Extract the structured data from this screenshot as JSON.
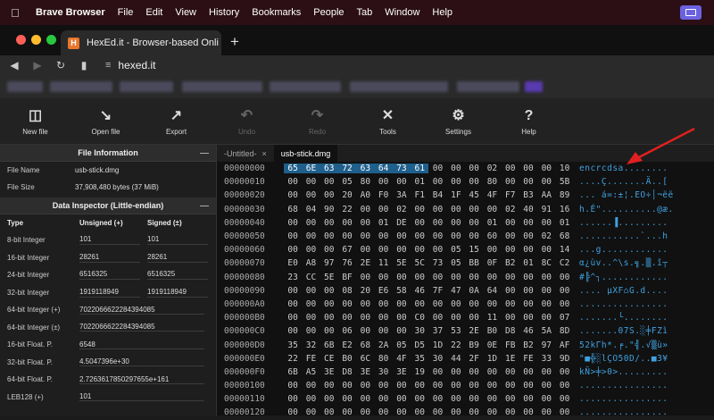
{
  "menubar": {
    "app_name": "Brave Browser",
    "items": [
      "File",
      "Edit",
      "View",
      "History",
      "Bookmarks",
      "People",
      "Tab",
      "Window",
      "Help"
    ]
  },
  "tab": {
    "title": "HexEd.it - Browser-based Onli",
    "favicon_letter": "H"
  },
  "address": {
    "url": "hexed.it"
  },
  "toolbar": [
    {
      "label": "New file",
      "icon": "new-file-icon",
      "enabled": true
    },
    {
      "label": "Open file",
      "icon": "open-file-icon",
      "enabled": true
    },
    {
      "label": "Export",
      "icon": "export-icon",
      "enabled": true
    },
    {
      "label": "Undo",
      "icon": "undo-icon",
      "enabled": false
    },
    {
      "label": "Redo",
      "icon": "redo-icon",
      "enabled": false
    },
    {
      "label": "Tools",
      "icon": "tools-icon",
      "enabled": true
    },
    {
      "label": "Settings",
      "icon": "gear-icon",
      "enabled": true
    },
    {
      "label": "Help",
      "icon": "help-icon",
      "enabled": true
    }
  ],
  "file_info": {
    "title": "File Information",
    "name_label": "File Name",
    "name_value": "usb-stick.dmg",
    "size_label": "File Size",
    "size_value": "37,908,480 bytes (37 MiB)"
  },
  "inspector": {
    "title": "Data Inspector (Little-endian)",
    "col_type": "Type",
    "col_unsigned": "Unsigned (+)",
    "col_signed": "Signed (±)",
    "rows": [
      {
        "type": "8-bit Integer",
        "u": "101",
        "s": "101"
      },
      {
        "type": "16-bit Integer",
        "u": "28261",
        "s": "28261"
      },
      {
        "type": "24-bit Integer",
        "u": "6516325",
        "s": "6516325"
      },
      {
        "type": "32-bit Integer",
        "u": "1919118949",
        "s": "1919118949"
      },
      {
        "type": "64-bit Integer (+)",
        "w": "7022066622284394085"
      },
      {
        "type": "64-bit Integer (±)",
        "w": "7022066622284394085"
      },
      {
        "type": "16-bit Float. P.",
        "w": "6548"
      },
      {
        "type": "32-bit Float. P.",
        "w": "4.5047396e+30"
      },
      {
        "type": "64-bit Float. P.",
        "w": "2.7263617850297655e+161"
      },
      {
        "type": "LEB128 (+)",
        "w": "101"
      }
    ]
  },
  "doc_tabs": [
    {
      "label": "-Untitled-",
      "active": false
    },
    {
      "label": "usb-stick.dmg",
      "active": true
    }
  ],
  "hex_lines": [
    {
      "off": "00000000",
      "bytes": [
        "65",
        "6E",
        "63",
        "72",
        "63",
        "64",
        "73",
        "61",
        "00",
        "00",
        "00",
        "02",
        "00",
        "00",
        "00",
        "10"
      ],
      "ascii": "encrcdsa........"
    },
    {
      "off": "00000010",
      "bytes": [
        "00",
        "00",
        "00",
        "05",
        "80",
        "00",
        "00",
        "01",
        "00",
        "00",
        "00",
        "80",
        "00",
        "00",
        "00",
        "5B"
      ],
      "ascii": "....Ç.......Ä..["
    },
    {
      "off": "00000020",
      "bytes": [
        "00",
        "00",
        "00",
        "20",
        "A0",
        "F0",
        "3A",
        "F1",
        "B4",
        "1F",
        "45",
        "4F",
        "F7",
        "B3",
        "AA",
        "89"
      ],
      "ascii": "... á=:±¦.EO÷│¬ëë"
    },
    {
      "off": "00000030",
      "bytes": [
        "68",
        "04",
        "90",
        "22",
        "00",
        "00",
        "02",
        "00",
        "00",
        "00",
        "00",
        "00",
        "02",
        "40",
        "91",
        "16"
      ],
      "ascii": "h.É\"..........@æ."
    },
    {
      "off": "00000040",
      "bytes": [
        "00",
        "00",
        "00",
        "00",
        "00",
        "01",
        "DE",
        "00",
        "00",
        "00",
        "00",
        "01",
        "00",
        "00",
        "00",
        "01"
      ],
      "ascii": "......▐........."
    },
    {
      "off": "00000050",
      "bytes": [
        "00",
        "00",
        "00",
        "00",
        "00",
        "00",
        "00",
        "00",
        "00",
        "00",
        "00",
        "60",
        "00",
        "00",
        "02",
        "68"
      ],
      "ascii": "...........`...h"
    },
    {
      "off": "00000060",
      "bytes": [
        "00",
        "00",
        "00",
        "67",
        "00",
        "00",
        "00",
        "00",
        "00",
        "05",
        "15",
        "00",
        "00",
        "00",
        "00",
        "14"
      ],
      "ascii": "...g............"
    },
    {
      "off": "00000070",
      "bytes": [
        "E0",
        "A8",
        "97",
        "76",
        "2E",
        "11",
        "5E",
        "5C",
        "73",
        "05",
        "BB",
        "0F",
        "B2",
        "01",
        "8C",
        "C2"
      ],
      "ascii": "α¿ùv..^\\s.╗.▒.î┬"
    },
    {
      "off": "00000080",
      "bytes": [
        "23",
        "CC",
        "5E",
        "BF",
        "00",
        "00",
        "00",
        "00",
        "00",
        "00",
        "00",
        "00",
        "00",
        "00",
        "00",
        "00"
      ],
      "ascii": "#╠^┐............"
    },
    {
      "off": "00000090",
      "bytes": [
        "00",
        "00",
        "00",
        "08",
        "20",
        "E6",
        "58",
        "46",
        "7F",
        "47",
        "0A",
        "64",
        "00",
        "00",
        "00",
        "00"
      ],
      "ascii": ".... µXF⌂G.d...."
    },
    {
      "off": "000000A0",
      "bytes": [
        "00",
        "00",
        "00",
        "00",
        "00",
        "00",
        "00",
        "00",
        "00",
        "00",
        "00",
        "00",
        "00",
        "00",
        "00",
        "00"
      ],
      "ascii": "................"
    },
    {
      "off": "000000B0",
      "bytes": [
        "00",
        "00",
        "00",
        "00",
        "00",
        "00",
        "00",
        "C0",
        "00",
        "00",
        "00",
        "11",
        "00",
        "00",
        "00",
        "07"
      ],
      "ascii": ".......└........"
    },
    {
      "off": "000000C0",
      "bytes": [
        "00",
        "00",
        "00",
        "06",
        "00",
        "00",
        "00",
        "30",
        "37",
        "53",
        "2E",
        "B0",
        "D8",
        "46",
        "5A",
        "8D"
      ],
      "ascii": ".......07S.░╪FZì"
    },
    {
      "off": "000000D0",
      "bytes": [
        "35",
        "32",
        "6B",
        "E2",
        "68",
        "2A",
        "05",
        "D5",
        "1D",
        "22",
        "B9",
        "0E",
        "FB",
        "B2",
        "97",
        "AF"
      ],
      "ascii": "52kΓh*.╒.\"╣.√▒ù»"
    },
    {
      "off": "000000E0",
      "bytes": [
        "22",
        "FE",
        "CE",
        "B0",
        "6C",
        "80",
        "4F",
        "35",
        "30",
        "44",
        "2F",
        "1D",
        "1E",
        "FE",
        "33",
        "9D"
      ],
      "ascii": "\"■╬░lÇO50D/..■3¥"
    },
    {
      "off": "000000F0",
      "bytes": [
        "6B",
        "A5",
        "3E",
        "D8",
        "3E",
        "30",
        "3E",
        "19",
        "00",
        "00",
        "00",
        "00",
        "00",
        "00",
        "00",
        "00"
      ],
      "ascii": "kÑ>╪>0>........."
    },
    {
      "off": "00000100",
      "bytes": [
        "00",
        "00",
        "00",
        "00",
        "00",
        "00",
        "00",
        "00",
        "00",
        "00",
        "00",
        "00",
        "00",
        "00",
        "00",
        "00"
      ],
      "ascii": "................"
    },
    {
      "off": "00000110",
      "bytes": [
        "00",
        "00",
        "00",
        "00",
        "00",
        "00",
        "00",
        "00",
        "00",
        "00",
        "00",
        "00",
        "00",
        "00",
        "00",
        "00"
      ],
      "ascii": "................"
    },
    {
      "off": "00000120",
      "bytes": [
        "00",
        "00",
        "00",
        "00",
        "00",
        "00",
        "00",
        "00",
        "00",
        "00",
        "00",
        "00",
        "00",
        "00",
        "00",
        "00"
      ],
      "ascii": "................"
    }
  ],
  "colors": {
    "selection": "#1f5f8b",
    "ascii": "#3fa1e0",
    "menubar": "#2b0f14",
    "annotation_arrow": "#e02020"
  }
}
